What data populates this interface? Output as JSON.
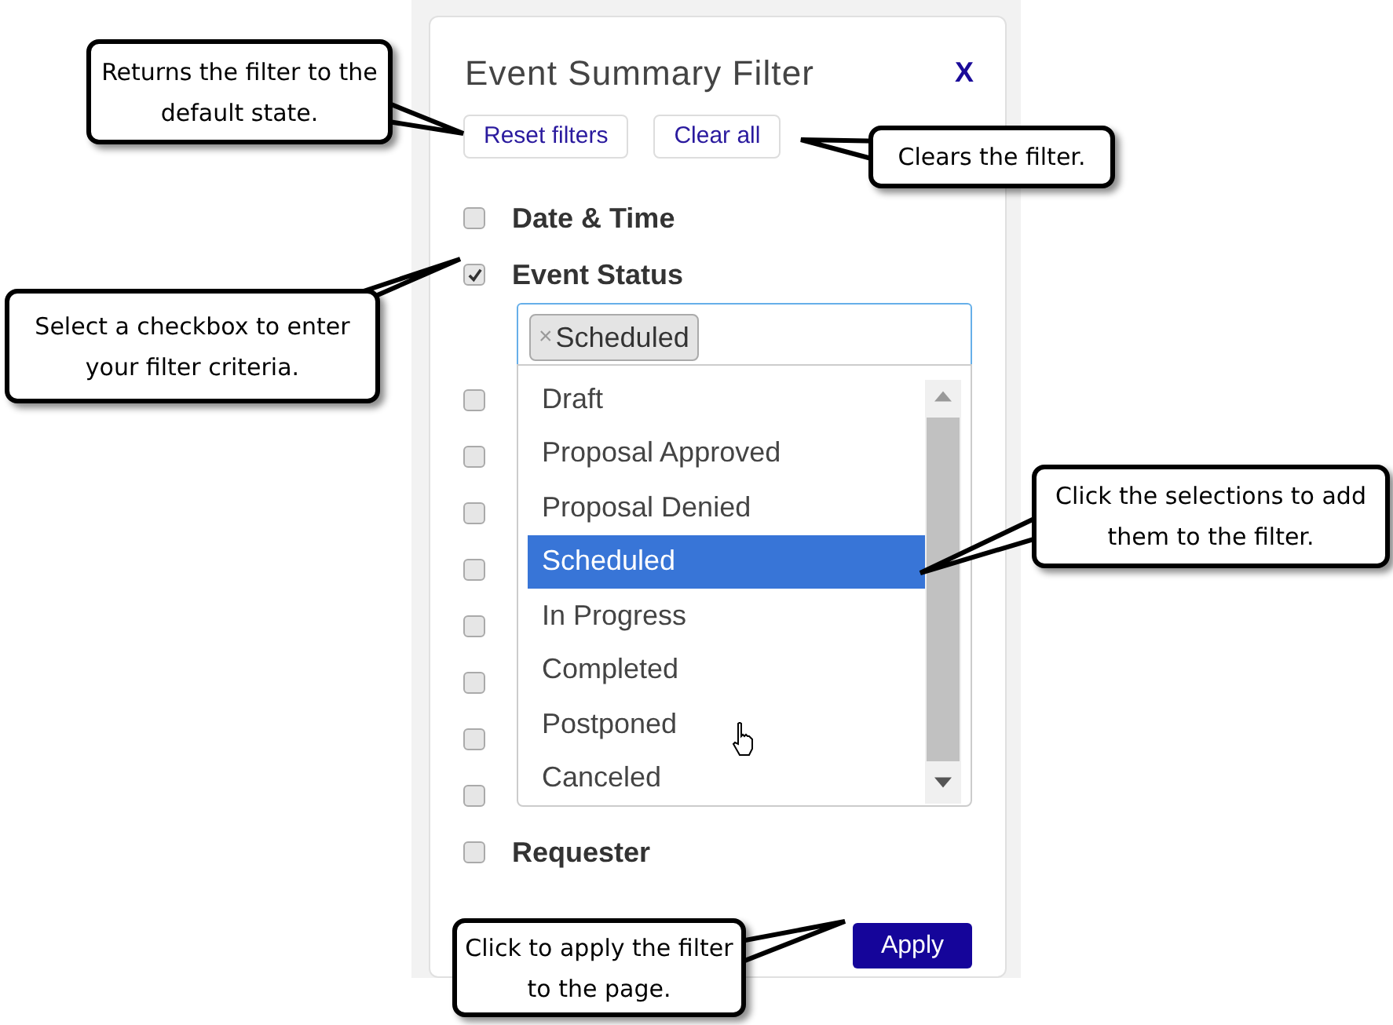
{
  "panel": {
    "title": "Event Summary Filter",
    "close": "X",
    "buttons": [
      "Reset filters",
      "Clear all"
    ],
    "filters": [
      {
        "label": "Date & Time",
        "checked": false
      },
      {
        "label": "Event Status",
        "checked": true,
        "tags": [
          {
            "remove": "×",
            "label": "Scheduled"
          }
        ]
      },
      {
        "checked": false
      },
      {
        "checked": false
      },
      {
        "checked": false
      },
      {
        "checked": false
      },
      {
        "checked": false
      },
      {
        "checked": false
      },
      {
        "checked": false
      },
      {
        "checked": false
      },
      {
        "label": "Requester",
        "checked": false
      }
    ],
    "dropdown": [
      {
        "label": "Draft",
        "selected": false
      },
      {
        "label": "Proposal Approved",
        "selected": false
      },
      {
        "label": "Proposal Denied",
        "selected": false
      },
      {
        "label": "Scheduled",
        "selected": true
      },
      {
        "label": "In Progress",
        "selected": false
      },
      {
        "label": "Completed",
        "selected": false
      },
      {
        "label": "Postponed",
        "selected": false
      },
      {
        "label": "Canceled",
        "selected": false
      }
    ],
    "apply": "Apply"
  },
  "callouts": [
    {
      "text": "Returns the filter to the default state."
    },
    {
      "text": "Clears the filter."
    },
    {
      "text": "Select a checkbox to enter your filter criteria."
    },
    {
      "text": "Click the selections to add them to the filter."
    },
    {
      "text": "Click to apply the filter to the page."
    }
  ]
}
